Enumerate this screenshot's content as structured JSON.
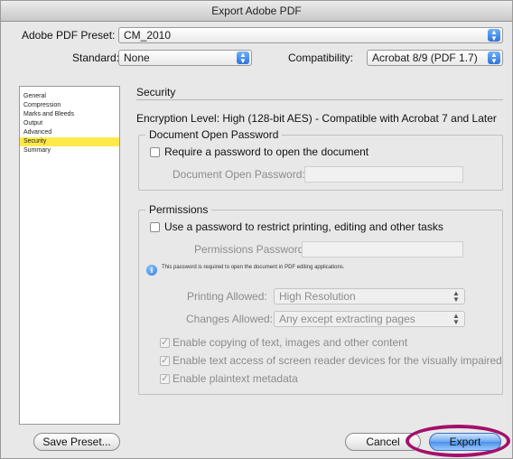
{
  "dialog": {
    "title": "Export Adobe PDF"
  },
  "preset": {
    "label": "Adobe PDF Preset:",
    "value": "CM_2010"
  },
  "standard": {
    "label": "Standard:",
    "value": "None"
  },
  "compatibility": {
    "label": "Compatibility:",
    "value": "Acrobat 8/9 (PDF 1.7)"
  },
  "sidebar": {
    "items": [
      {
        "label": "General",
        "selected": false
      },
      {
        "label": "Compression",
        "selected": false
      },
      {
        "label": "Marks and Bleeds",
        "selected": false
      },
      {
        "label": "Output",
        "selected": false
      },
      {
        "label": "Advanced",
        "selected": false
      },
      {
        "label": "Security",
        "selected": true
      },
      {
        "label": "Summary",
        "selected": false
      }
    ]
  },
  "security": {
    "title": "Security",
    "encryption_text": "Encryption Level: High (128-bit AES) - Compatible with Acrobat 7 and Later",
    "open_password": {
      "legend": "Document Open Password",
      "require_label": "Require a password to open the document",
      "require_checked": false,
      "field_label": "Document Open Password:",
      "field_value": ""
    },
    "permissions": {
      "legend": "Permissions",
      "use_password_label": "Use a password to restrict printing, editing and other tasks",
      "use_password_checked": false,
      "field_label": "Permissions Password:",
      "field_value": "",
      "info_text": "This password is required to open the document in PDF editing applications.",
      "printing_label": "Printing Allowed:",
      "printing_value": "High Resolution",
      "changes_label": "Changes Allowed:",
      "changes_value": "Any except extracting pages",
      "options": [
        {
          "label": "Enable copying of text, images and other content",
          "checked": true
        },
        {
          "label": "Enable text access of screen reader devices for the visually impaired",
          "checked": true
        },
        {
          "label": "Enable plaintext metadata",
          "checked": true
        }
      ]
    }
  },
  "buttons": {
    "save_preset": "Save Preset...",
    "cancel": "Cancel",
    "export": "Export"
  },
  "colors": {
    "selection_highlight": "#ffe94a",
    "annotation_ring": "#a3106a",
    "primary_button": "#4a90ea"
  },
  "icons": {
    "stepper": "up-down-arrows",
    "info": "info-circle"
  }
}
